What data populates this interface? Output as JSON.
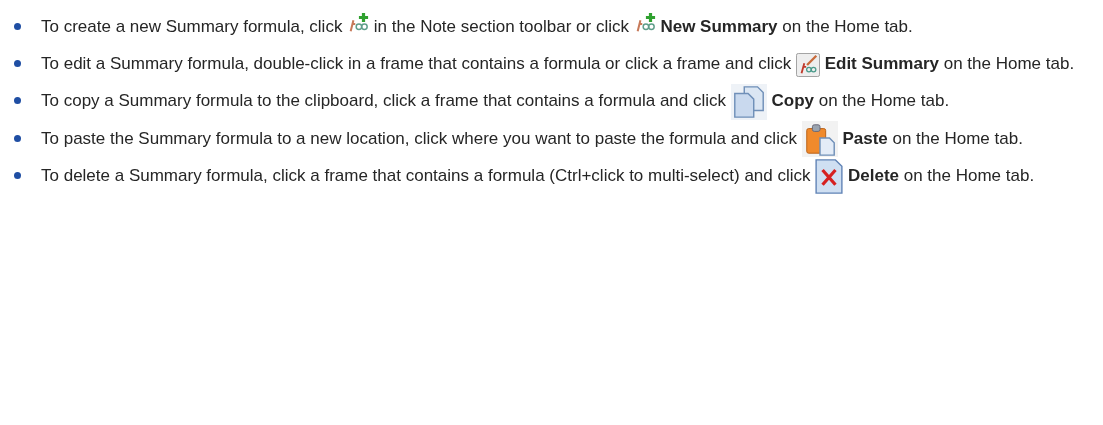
{
  "items": [
    {
      "segments": [
        {
          "kind": "text",
          "text": "To create a new Summary formula, click "
        },
        {
          "kind": "new-formula"
        },
        {
          "kind": "text",
          "text": " in the Note section toolbar or click "
        },
        {
          "kind": "new-formula"
        },
        {
          "kind": "text",
          "text": " **New Summary** on the Home tab."
        }
      ]
    },
    {
      "segments": [
        {
          "kind": "text",
          "text": "To edit a Summary formula, double-click in a frame that contains a formula or click a frame and click "
        },
        {
          "kind": "edit-formula"
        },
        {
          "kind": "text",
          "text": " **Edit Summary** on the Home tab."
        }
      ]
    },
    {
      "segments": [
        {
          "kind": "text",
          "text": "To copy a Summary formula to the clipboard, click a frame that contains a formula and click "
        },
        {
          "kind": "copy"
        },
        {
          "kind": "text",
          "text": " **Copy** on the Home tab."
        }
      ]
    },
    {
      "segments": [
        {
          "kind": "text",
          "text": "To paste the Summary formula to a new location, click where you want to paste the formula and click "
        },
        {
          "kind": "paste"
        },
        {
          "kind": "text",
          "text": " **Paste** on the Home tab."
        }
      ]
    },
    {
      "segments": [
        {
          "kind": "text",
          "text": "To delete a Summary formula, click a frame that contains a formula (Ctrl+click to multi-select) and click "
        },
        {
          "kind": "delete"
        },
        {
          "kind": "text",
          "text": " **Delete** on the Home tab."
        }
      ]
    }
  ]
}
